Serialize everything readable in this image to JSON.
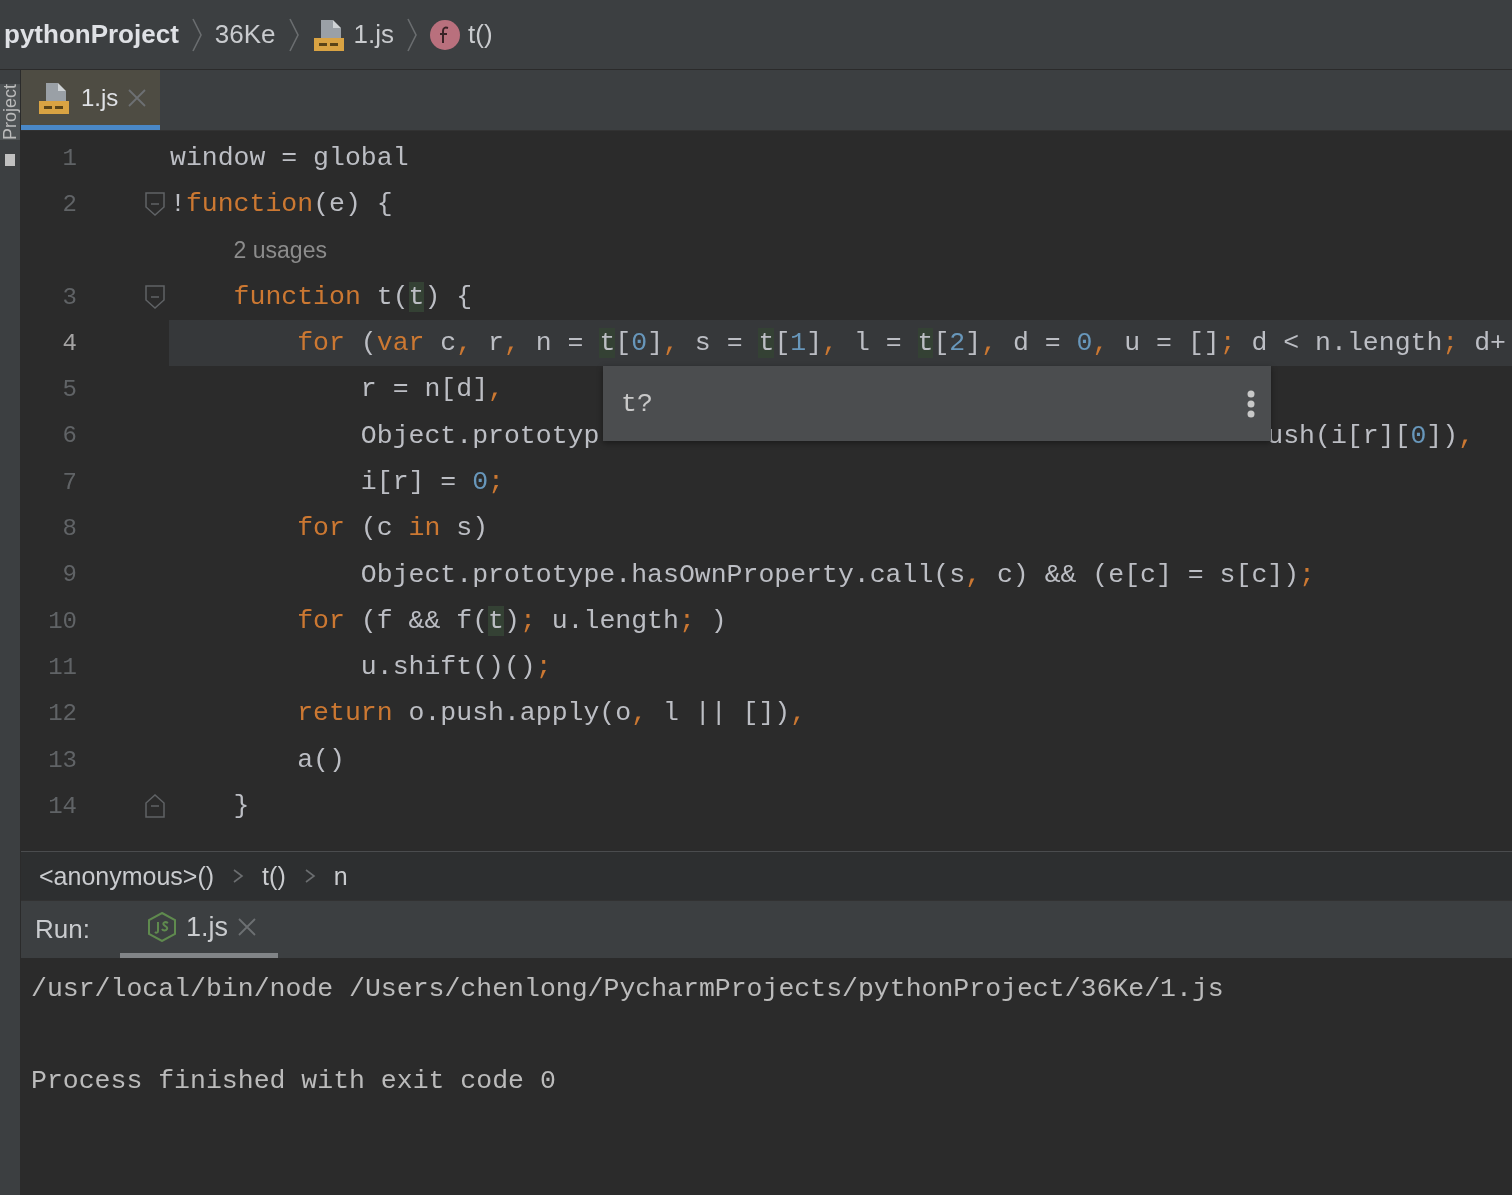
{
  "breadcrumbs": [
    {
      "label": "pythonProject",
      "kind": "project"
    },
    {
      "label": "36Ke",
      "kind": "folder"
    },
    {
      "label": "1.js",
      "kind": "jsfile"
    },
    {
      "label": "t()",
      "kind": "function"
    }
  ],
  "tool_strip": {
    "label": "Project"
  },
  "editor": {
    "tabs": [
      {
        "label": "1.js",
        "selected": true
      }
    ],
    "lines": [
      {
        "kind": "code",
        "number": "1",
        "tokens": [
          {
            "kind": "plain",
            "text": "window = global"
          }
        ]
      },
      {
        "kind": "code",
        "number": "2",
        "fold": {
          "kind": "start"
        },
        "tokens": [
          {
            "kind": "plain",
            "text": "!"
          },
          {
            "kind": "keyword",
            "text": "function"
          },
          {
            "kind": "plain",
            "text": "(e) {"
          }
        ]
      },
      {
        "kind": "hint",
        "text": "2 usages"
      },
      {
        "kind": "code",
        "number": "3",
        "fold": {
          "kind": "start"
        },
        "tokens": [
          {
            "kind": "keyword",
            "text": "    function"
          },
          {
            "kind": "plain",
            "text": " t("
          },
          {
            "kind": "param",
            "text": "t"
          },
          {
            "kind": "plain",
            "text": ") {"
          }
        ]
      },
      {
        "kind": "code",
        "number": "4",
        "current": true,
        "tokens": [
          {
            "kind": "keyword",
            "text": "        for"
          },
          {
            "kind": "plain",
            "text": " ("
          },
          {
            "kind": "keyword",
            "text": "var"
          },
          {
            "kind": "plain",
            "text": " c"
          },
          {
            "kind": "keyword",
            "text": ","
          },
          {
            "kind": "plain",
            "text": " r"
          },
          {
            "kind": "keyword",
            "text": ","
          },
          {
            "kind": "plain",
            "text": " n = "
          },
          {
            "kind": "param",
            "text": "t"
          },
          {
            "kind": "plain",
            "text": "["
          },
          {
            "kind": "number",
            "text": "0"
          },
          {
            "kind": "plain",
            "text": "]"
          },
          {
            "kind": "keyword",
            "text": ","
          },
          {
            "kind": "plain",
            "text": " s = "
          },
          {
            "kind": "param",
            "text": "t"
          },
          {
            "kind": "plain",
            "text": "["
          },
          {
            "kind": "number",
            "text": "1"
          },
          {
            "kind": "plain",
            "text": "]"
          },
          {
            "kind": "keyword",
            "text": ","
          },
          {
            "kind": "plain",
            "text": " l = "
          },
          {
            "kind": "param",
            "text": "t"
          },
          {
            "kind": "plain",
            "text": "["
          },
          {
            "kind": "number",
            "text": "2"
          },
          {
            "kind": "plain",
            "text": "]"
          },
          {
            "kind": "keyword",
            "text": ","
          },
          {
            "kind": "plain",
            "text": " d = "
          },
          {
            "kind": "number",
            "text": "0"
          },
          {
            "kind": "keyword",
            "text": ","
          },
          {
            "kind": "plain",
            "text": " u = []"
          },
          {
            "kind": "keyword",
            "text": ";"
          },
          {
            "kind": "plain",
            "text": " d < n.length"
          },
          {
            "kind": "keyword",
            "text": ";"
          },
          {
            "kind": "plain",
            "text": " d+"
          }
        ]
      },
      {
        "kind": "code",
        "number": "5",
        "tokens": [
          {
            "kind": "plain",
            "text": "            r = n[d]"
          },
          {
            "kind": "keyword",
            "text": ","
          }
        ]
      },
      {
        "kind": "code",
        "number": "6",
        "tokens": [
          {
            "kind": "plain",
            "text": "            Object.prototyp"
          }
        ],
        "tokens_after_tooltip": [
          {
            "kind": "plain",
            "text": "ush(i[r]["
          },
          {
            "kind": "number",
            "text": "0"
          },
          {
            "kind": "plain",
            "text": "])"
          },
          {
            "kind": "keyword",
            "text": ","
          }
        ]
      },
      {
        "kind": "code",
        "number": "7",
        "tokens": [
          {
            "kind": "plain",
            "text": "            i[r] = "
          },
          {
            "kind": "number",
            "text": "0"
          },
          {
            "kind": "keyword",
            "text": ";"
          }
        ]
      },
      {
        "kind": "code",
        "number": "8",
        "tokens": [
          {
            "kind": "keyword",
            "text": "        for"
          },
          {
            "kind": "plain",
            "text": " (c "
          },
          {
            "kind": "keyword",
            "text": "in"
          },
          {
            "kind": "plain",
            "text": " s)"
          }
        ]
      },
      {
        "kind": "code",
        "number": "9",
        "tokens": [
          {
            "kind": "plain",
            "text": "            Object.prototype.hasOwnProperty.call(s"
          },
          {
            "kind": "keyword",
            "text": ","
          },
          {
            "kind": "plain",
            "text": " c) && (e[c] = s[c])"
          },
          {
            "kind": "keyword",
            "text": ";"
          }
        ]
      },
      {
        "kind": "code",
        "number": "10",
        "tokens": [
          {
            "kind": "keyword",
            "text": "        for"
          },
          {
            "kind": "plain",
            "text": " (f && f("
          },
          {
            "kind": "param",
            "text": "t"
          },
          {
            "kind": "plain",
            "text": ")"
          },
          {
            "kind": "keyword",
            "text": ";"
          },
          {
            "kind": "plain",
            "text": " u.length"
          },
          {
            "kind": "keyword",
            "text": ";"
          },
          {
            "kind": "plain",
            "text": " )"
          }
        ]
      },
      {
        "kind": "code",
        "number": "11",
        "tokens": [
          {
            "kind": "plain",
            "text": "            u.shift()()"
          },
          {
            "kind": "keyword",
            "text": ";"
          }
        ]
      },
      {
        "kind": "code",
        "number": "12",
        "tokens": [
          {
            "kind": "keyword",
            "text": "        return"
          },
          {
            "kind": "plain",
            "text": " o.push.apply(o"
          },
          {
            "kind": "keyword",
            "text": ","
          },
          {
            "kind": "plain",
            "text": " l || [])"
          },
          {
            "kind": "keyword",
            "text": ","
          }
        ]
      },
      {
        "kind": "code",
        "number": "13",
        "tokens": [
          {
            "kind": "plain",
            "text": "        a()"
          }
        ]
      },
      {
        "kind": "code",
        "number": "14",
        "fold": {
          "kind": "end"
        },
        "tokens": [
          {
            "kind": "plain",
            "text": "    }"
          }
        ]
      }
    ],
    "tooltip": {
      "text": "t?"
    }
  },
  "nav_path": [
    "<anonymous>()",
    "t()",
    "n"
  ],
  "run_panel": {
    "label": "Run:",
    "tabs": [
      {
        "label": "1.js",
        "selected": true
      }
    ],
    "console": [
      {
        "kind": "command",
        "text": "/usr/local/bin/node /Users/chenlong/PycharmProjects/pythonProject/36Ke/1.js"
      },
      {
        "kind": "status",
        "text": "Process finished with exit code 0"
      }
    ]
  }
}
